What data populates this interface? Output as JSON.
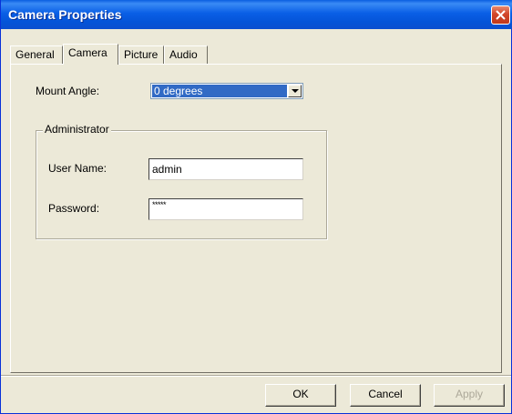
{
  "window": {
    "title": "Camera Properties"
  },
  "tabs": [
    {
      "label": "General"
    },
    {
      "label": "Camera"
    },
    {
      "label": "Picture"
    },
    {
      "label": "Audio"
    }
  ],
  "active_tab": "Camera",
  "mount_angle": {
    "label": "Mount Angle:",
    "value": "0 degrees"
  },
  "administrator": {
    "title": "Administrator",
    "username_label": "User Name:",
    "username_value": "admin",
    "password_label": "Password:",
    "password_value": "*****"
  },
  "buttons": {
    "ok": "OK",
    "cancel": "Cancel",
    "apply": "Apply"
  },
  "colors": {
    "titlebar": "#0a5fe6",
    "close": "#c0391c",
    "selection": "#316ac5",
    "face": "#ece9d8"
  }
}
